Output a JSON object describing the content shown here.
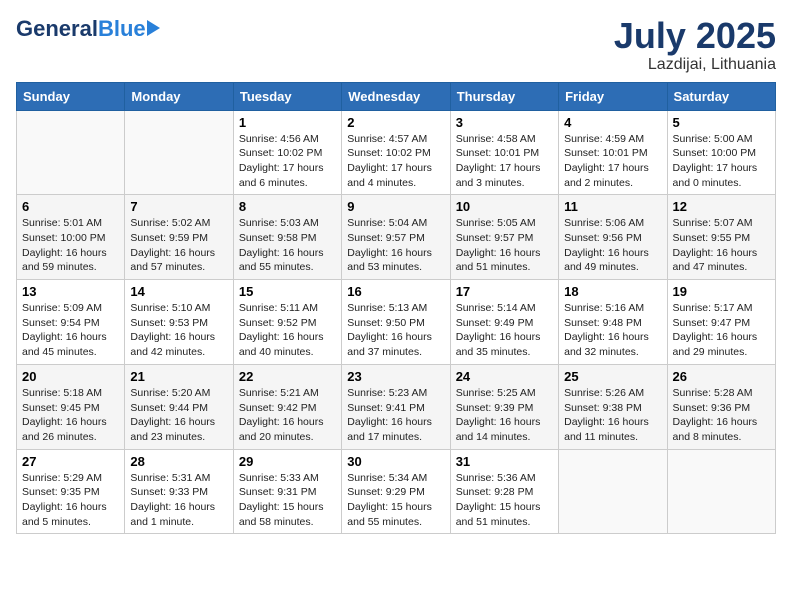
{
  "header": {
    "logo_general": "General",
    "logo_blue": "Blue",
    "month_year": "July 2025",
    "location": "Lazdijai, Lithuania"
  },
  "weekdays": [
    "Sunday",
    "Monday",
    "Tuesday",
    "Wednesday",
    "Thursday",
    "Friday",
    "Saturday"
  ],
  "weeks": [
    [
      {
        "day": "",
        "info": ""
      },
      {
        "day": "",
        "info": ""
      },
      {
        "day": "1",
        "info": "Sunrise: 4:56 AM\nSunset: 10:02 PM\nDaylight: 17 hours\nand 6 minutes."
      },
      {
        "day": "2",
        "info": "Sunrise: 4:57 AM\nSunset: 10:02 PM\nDaylight: 17 hours\nand 4 minutes."
      },
      {
        "day": "3",
        "info": "Sunrise: 4:58 AM\nSunset: 10:01 PM\nDaylight: 17 hours\nand 3 minutes."
      },
      {
        "day": "4",
        "info": "Sunrise: 4:59 AM\nSunset: 10:01 PM\nDaylight: 17 hours\nand 2 minutes."
      },
      {
        "day": "5",
        "info": "Sunrise: 5:00 AM\nSunset: 10:00 PM\nDaylight: 17 hours\nand 0 minutes."
      }
    ],
    [
      {
        "day": "6",
        "info": "Sunrise: 5:01 AM\nSunset: 10:00 PM\nDaylight: 16 hours\nand 59 minutes."
      },
      {
        "day": "7",
        "info": "Sunrise: 5:02 AM\nSunset: 9:59 PM\nDaylight: 16 hours\nand 57 minutes."
      },
      {
        "day": "8",
        "info": "Sunrise: 5:03 AM\nSunset: 9:58 PM\nDaylight: 16 hours\nand 55 minutes."
      },
      {
        "day": "9",
        "info": "Sunrise: 5:04 AM\nSunset: 9:57 PM\nDaylight: 16 hours\nand 53 minutes."
      },
      {
        "day": "10",
        "info": "Sunrise: 5:05 AM\nSunset: 9:57 PM\nDaylight: 16 hours\nand 51 minutes."
      },
      {
        "day": "11",
        "info": "Sunrise: 5:06 AM\nSunset: 9:56 PM\nDaylight: 16 hours\nand 49 minutes."
      },
      {
        "day": "12",
        "info": "Sunrise: 5:07 AM\nSunset: 9:55 PM\nDaylight: 16 hours\nand 47 minutes."
      }
    ],
    [
      {
        "day": "13",
        "info": "Sunrise: 5:09 AM\nSunset: 9:54 PM\nDaylight: 16 hours\nand 45 minutes."
      },
      {
        "day": "14",
        "info": "Sunrise: 5:10 AM\nSunset: 9:53 PM\nDaylight: 16 hours\nand 42 minutes."
      },
      {
        "day": "15",
        "info": "Sunrise: 5:11 AM\nSunset: 9:52 PM\nDaylight: 16 hours\nand 40 minutes."
      },
      {
        "day": "16",
        "info": "Sunrise: 5:13 AM\nSunset: 9:50 PM\nDaylight: 16 hours\nand 37 minutes."
      },
      {
        "day": "17",
        "info": "Sunrise: 5:14 AM\nSunset: 9:49 PM\nDaylight: 16 hours\nand 35 minutes."
      },
      {
        "day": "18",
        "info": "Sunrise: 5:16 AM\nSunset: 9:48 PM\nDaylight: 16 hours\nand 32 minutes."
      },
      {
        "day": "19",
        "info": "Sunrise: 5:17 AM\nSunset: 9:47 PM\nDaylight: 16 hours\nand 29 minutes."
      }
    ],
    [
      {
        "day": "20",
        "info": "Sunrise: 5:18 AM\nSunset: 9:45 PM\nDaylight: 16 hours\nand 26 minutes."
      },
      {
        "day": "21",
        "info": "Sunrise: 5:20 AM\nSunset: 9:44 PM\nDaylight: 16 hours\nand 23 minutes."
      },
      {
        "day": "22",
        "info": "Sunrise: 5:21 AM\nSunset: 9:42 PM\nDaylight: 16 hours\nand 20 minutes."
      },
      {
        "day": "23",
        "info": "Sunrise: 5:23 AM\nSunset: 9:41 PM\nDaylight: 16 hours\nand 17 minutes."
      },
      {
        "day": "24",
        "info": "Sunrise: 5:25 AM\nSunset: 9:39 PM\nDaylight: 16 hours\nand 14 minutes."
      },
      {
        "day": "25",
        "info": "Sunrise: 5:26 AM\nSunset: 9:38 PM\nDaylight: 16 hours\nand 11 minutes."
      },
      {
        "day": "26",
        "info": "Sunrise: 5:28 AM\nSunset: 9:36 PM\nDaylight: 16 hours\nand 8 minutes."
      }
    ],
    [
      {
        "day": "27",
        "info": "Sunrise: 5:29 AM\nSunset: 9:35 PM\nDaylight: 16 hours\nand 5 minutes."
      },
      {
        "day": "28",
        "info": "Sunrise: 5:31 AM\nSunset: 9:33 PM\nDaylight: 16 hours\nand 1 minute."
      },
      {
        "day": "29",
        "info": "Sunrise: 5:33 AM\nSunset: 9:31 PM\nDaylight: 15 hours\nand 58 minutes."
      },
      {
        "day": "30",
        "info": "Sunrise: 5:34 AM\nSunset: 9:29 PM\nDaylight: 15 hours\nand 55 minutes."
      },
      {
        "day": "31",
        "info": "Sunrise: 5:36 AM\nSunset: 9:28 PM\nDaylight: 15 hours\nand 51 minutes."
      },
      {
        "day": "",
        "info": ""
      },
      {
        "day": "",
        "info": ""
      }
    ]
  ]
}
